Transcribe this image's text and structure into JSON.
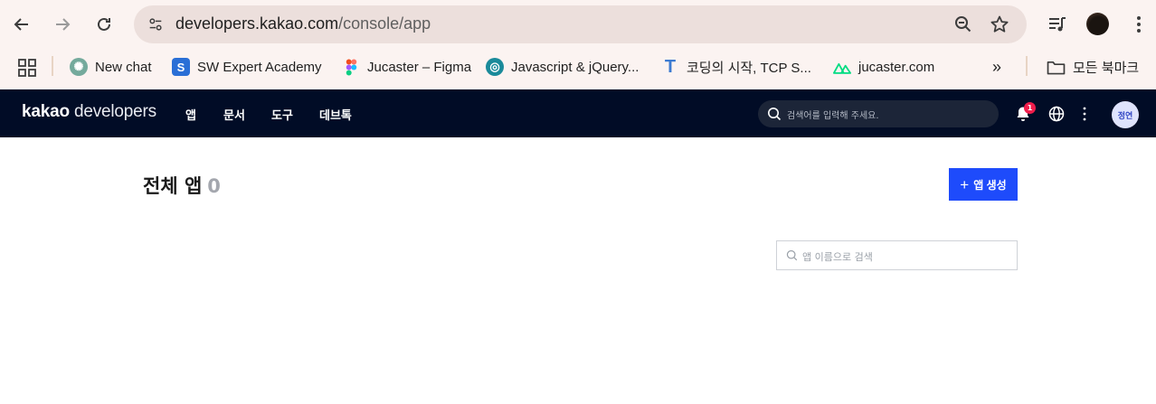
{
  "browser": {
    "url_host": "developers.kakao.com",
    "url_path": "/console/app"
  },
  "bookmarks": [
    {
      "label": "New chat",
      "icon": "chatgpt-icon"
    },
    {
      "label": "SW Expert Academy",
      "icon": "swea-icon"
    },
    {
      "label": "Jucaster – Figma",
      "icon": "figma-icon"
    },
    {
      "label": "Javascript & jQuery...",
      "icon": "globe-site-icon"
    },
    {
      "label": "코딩의 시작, TCP S...",
      "icon": "tcp-t-icon"
    },
    {
      "label": "jucaster.com",
      "icon": "nuxt-icon"
    }
  ],
  "bookmarks_folder": "모든 북마크",
  "kakao": {
    "logo_bold": "kakao",
    "logo_rest": " developers",
    "nav": [
      "앱",
      "문서",
      "도구",
      "데브톡"
    ],
    "search_placeholder": "검색어를 입력해 주세요.",
    "notification_count": "1",
    "user_avatar_text": "정연"
  },
  "page": {
    "title": "전체 앱",
    "count": "0",
    "create_button": "앱 생성",
    "app_search_placeholder": "앱 이름으로 검색"
  },
  "colors": {
    "header_bg": "#010c26",
    "primary_button": "#1e4bfb",
    "badge": "#ef1d4b"
  }
}
